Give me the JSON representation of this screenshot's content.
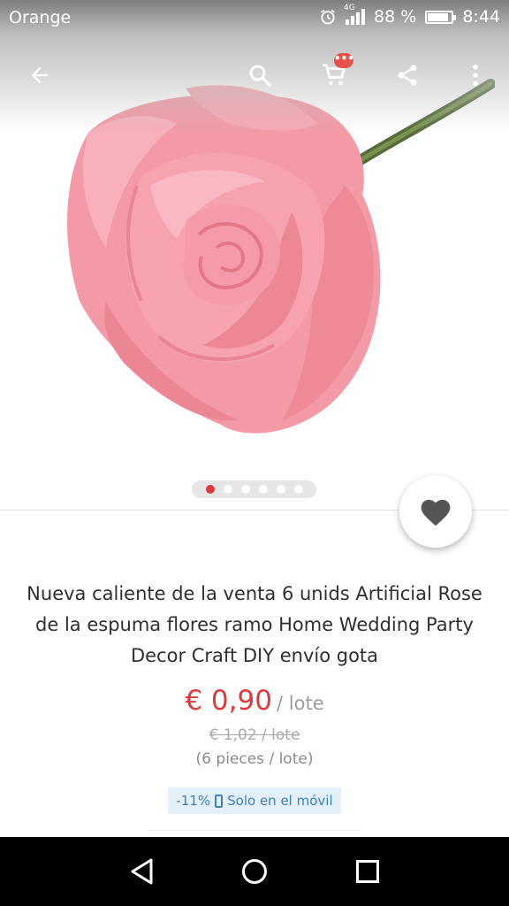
{
  "status_bar": {
    "carrier": "Orange",
    "network": "4G",
    "battery_text": "88 %",
    "battery_level": 0.88,
    "time": "8:44",
    "icons": [
      "alarm-icon",
      "signal-icon",
      "battery-icon"
    ]
  },
  "toolbar": {
    "cart_badge": "•••",
    "icons": [
      "back-arrow-icon",
      "search-icon",
      "cart-icon",
      "share-icon",
      "more-vert-icon"
    ]
  },
  "gallery": {
    "image_count": 6,
    "active_index": 0
  },
  "product": {
    "title": "Nueva caliente de la venta 6 unids Artificial Rose de la espuma flores ramo Home Wedding Party Decor Craft DIY envío gota",
    "price": "€ 0,90",
    "per_unit": "/ lote",
    "old_price": "€ 1,02 / lote",
    "pieces": "(6 pieces / lote)",
    "discount": "-11%",
    "mobile_only": "Solo en el móvil"
  },
  "colors": {
    "accent_red": "#e0393b",
    "promo_blue": "#3f7fbf",
    "promo_bg": "#e3f0fa",
    "rose_pink": "#f49aa8"
  },
  "navbar": {
    "icons": [
      "back-triangle-icon",
      "home-circle-icon",
      "recents-square-icon"
    ]
  }
}
